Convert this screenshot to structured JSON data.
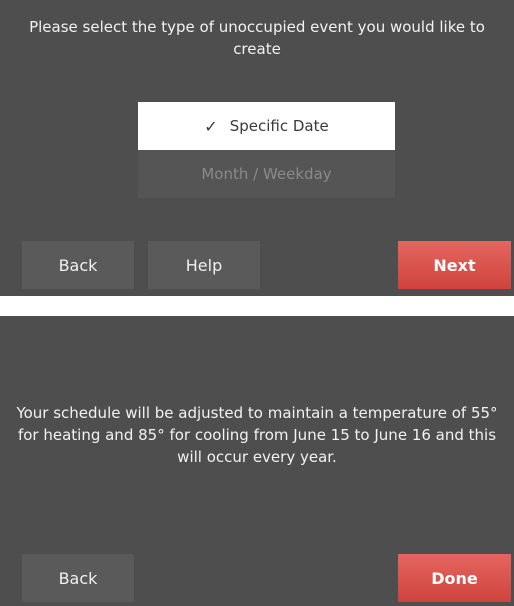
{
  "screen1": {
    "prompt": "Please select the type of unoccupied event you would like to create",
    "options": [
      {
        "label": "Specific Date",
        "selected": true
      },
      {
        "label": "Month / Weekday",
        "selected": false
      }
    ],
    "check_glyph": "✓",
    "buttons": {
      "back": "Back",
      "help": "Help",
      "next": "Next"
    }
  },
  "screen2": {
    "message": "Your schedule will be adjusted to maintain a temperature of 55° for heating and 85° for cooling from June 15 to June 16 and this will occur every year.",
    "buttons": {
      "back": "Back",
      "done": "Done"
    }
  },
  "colors": {
    "screen_bg": "#4e4e4e",
    "button_bg": "#5a5a5a",
    "primary_button": "#d9514b",
    "selected_option_bg": "#ffffff"
  },
  "icons": {
    "check": "checkmark-icon"
  }
}
